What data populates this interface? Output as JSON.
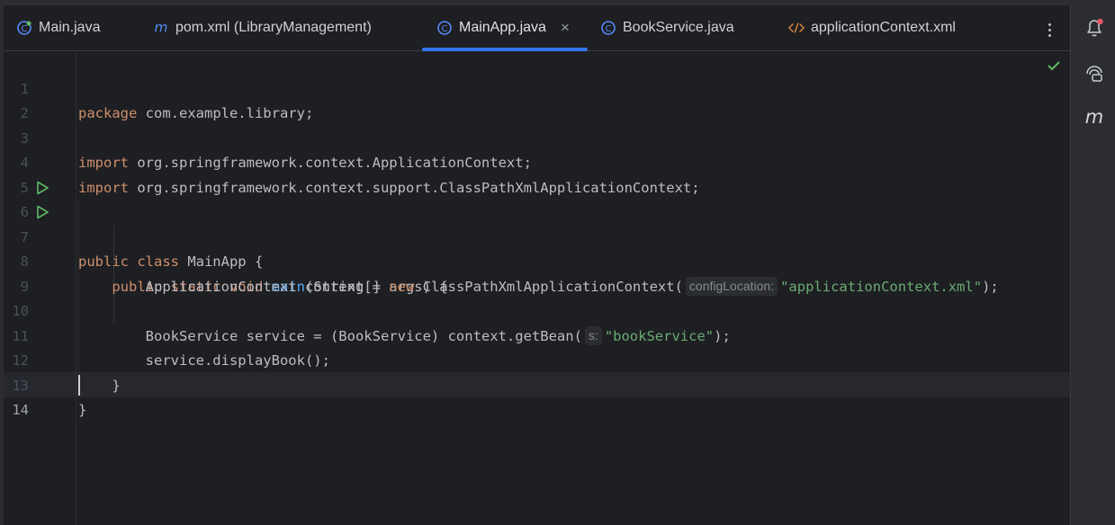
{
  "tabs": [
    {
      "label": "Main.java",
      "icon": "java-class-icon"
    },
    {
      "label": "pom.xml (LibraryManagement)",
      "icon": "maven-icon"
    },
    {
      "label": "MainApp.java",
      "icon": "java-class-icon",
      "active": true
    },
    {
      "label": "BookService.java",
      "icon": "java-class-icon"
    },
    {
      "label": "applicationContext.xml",
      "icon": "xml-icon"
    }
  ],
  "close_glyph": "×",
  "lines": {
    "n1": "1",
    "n2": "2",
    "n3": "3",
    "n4": "4",
    "n5": "5",
    "n6": "6",
    "n7": "7",
    "n8": "8",
    "n9": "9",
    "n10": "10",
    "n11": "11",
    "n12": "12",
    "n13": "13",
    "n14": "14"
  },
  "code": {
    "l1_kw": "package",
    "l1_rest": " com.example.library;",
    "l3_kw": "import",
    "l3_rest": " org.springframework.context.ApplicationContext;",
    "l4_kw": "import",
    "l4_rest": " org.springframework.context.support.ClassPathXmlApplicationContext;",
    "l6_kw": "public class",
    "l6_rest": " MainApp {",
    "l7_indent": "    ",
    "l7_kw": "public static void",
    "l7_sp": " ",
    "l7_fn": "main",
    "l7_rest": "(String[] args) {",
    "l8_pre": "        ApplicationContext context = ",
    "l8_kw": "new",
    "l8_mid": " ClassPathXmlApplicationContext(",
    "l8_hint": "configLocation:",
    "l8_str": "\"applicationContext.xml\"",
    "l8_end": ");",
    "l10_pre": "        BookService service = (BookService) context.getBean(",
    "l10_hint": "s:",
    "l10_str": "\"bookService\"",
    "l10_end": ");",
    "l11": "        service.displayBook();",
    "l12": "    }",
    "l13": "}"
  },
  "colors": {
    "keyword": "#cf8e6d",
    "function": "#56a8f5",
    "string": "#6aab73",
    "accent": "#3574f0",
    "check": "#5fb865",
    "notification_dot": "#e55765"
  }
}
